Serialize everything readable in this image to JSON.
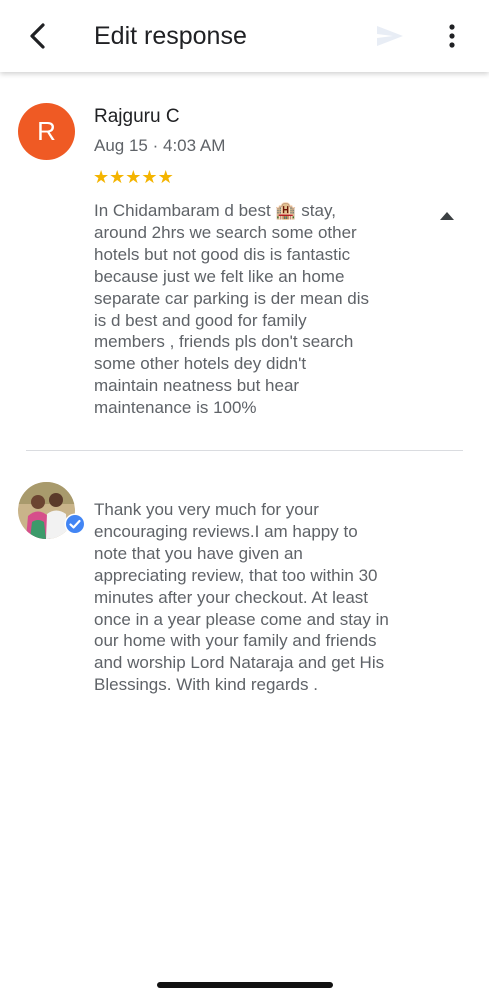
{
  "header": {
    "title": "Edit response",
    "back_icon": "arrow-back-icon",
    "send_icon": "send-icon",
    "more_icon": "more-vert-icon"
  },
  "review": {
    "avatar_letter": "R",
    "avatar_color": "#ef5a24",
    "reviewer_name": "Rajguru C",
    "date": "Aug 15 · 4:03 AM",
    "rating": 5,
    "stars": [
      "★",
      "★",
      "★",
      "★",
      "★"
    ],
    "star_color": "#f4b400",
    "text": "In Chidambaram d best 🏨 stay,\naround 2hrs we search some other\nhotels but not good dis is fantastic\nbecause just we felt like an home\nseparate car parking is der mean dis\nis d best and good for family\nmembers , friends pls don't search\nsome other hotels dey didn't\nmaintain neatness but hear\nmaintenance is 100%",
    "collapse_icon": "arrow-up-icon"
  },
  "owner_response": {
    "avatar_icon": "owner-photo-avatar",
    "badge_icon": "verified-check-icon",
    "badge_color": "#4285f4",
    "text": "Thank you very much for your\nencouraging reviews.I am happy to\nnote that you have given an\nappreciating review, that too within 30\nminutes after your checkout. At least\nonce in a year please come and stay in\nour home with your family and friends\nand worship Lord Nataraja and get His\nBlessings. With kind regards ."
  }
}
